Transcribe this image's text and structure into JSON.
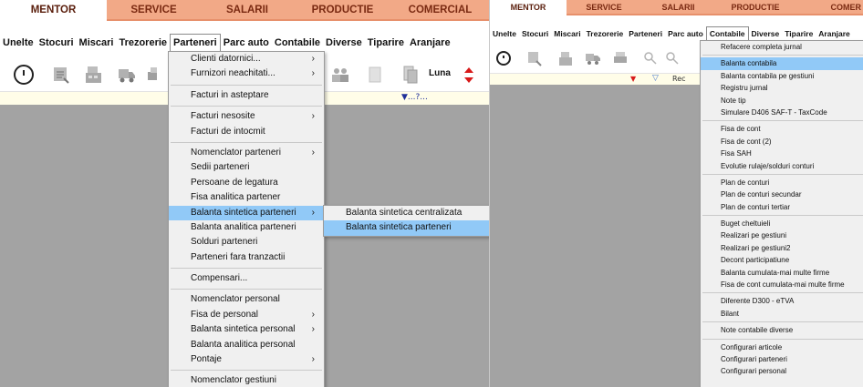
{
  "left": {
    "tabs": [
      "MENTOR",
      "SERVICE",
      "SALARII",
      "PRODUCTIE",
      "COMERCIAL"
    ],
    "menubar": [
      "Unelte",
      "Stocuri",
      "Miscari",
      "Trezorerie",
      "Parteneri",
      "Parc auto",
      "Contabile",
      "Diverse",
      "Tiparire",
      "Aranjare"
    ],
    "toolbar": {
      "luna_label": "Luna",
      "strip_text": "▼...?..."
    },
    "parteneri_menu": [
      {
        "label": "Clienti datornici...",
        "arrow": "›"
      },
      {
        "label": "Furnizori neachitati...",
        "arrow": "›"
      },
      {
        "sep": true
      },
      {
        "label": "Facturi in asteptare"
      },
      {
        "sep": true
      },
      {
        "label": "Facturi nesosite",
        "arrow": "›"
      },
      {
        "label": "Facturi de intocmit"
      },
      {
        "sep": true
      },
      {
        "label": "Nomenclator parteneri",
        "arrow": "›"
      },
      {
        "label": "Sedii parteneri"
      },
      {
        "label": "Persoane de legatura"
      },
      {
        "label": "Fisa analitica partener"
      },
      {
        "label": "Balanta sintetica parteneri",
        "arrow": "›",
        "highlight": true
      },
      {
        "label": "Balanta analitica parteneri"
      },
      {
        "label": "Solduri parteneri"
      },
      {
        "label": "Parteneri fara tranzactii"
      },
      {
        "sep": true
      },
      {
        "label": "Compensari..."
      },
      {
        "sep": true
      },
      {
        "label": "Nomenclator personal"
      },
      {
        "label": "Fisa de personal",
        "arrow": "›"
      },
      {
        "label": "Balanta sintetica personal",
        "arrow": "›"
      },
      {
        "label": "Balanta analitica personal"
      },
      {
        "label": "Pontaje",
        "arrow": "›"
      },
      {
        "sep": true
      },
      {
        "label": "Nomenclator gestiuni"
      }
    ],
    "balanta_submenu": [
      {
        "label": "Balanta sintetica centralizata"
      },
      {
        "label": "Balanta sintetica parteneri",
        "highlight": true
      }
    ]
  },
  "right": {
    "tabs": [
      "MENTOR",
      "SERVICE",
      "SALARII",
      "PRODUCTIE",
      "COMER"
    ],
    "menubar": [
      "Unelte",
      "Stocuri",
      "Miscari",
      "Trezorerie",
      "Parteneri",
      "Parc auto",
      "Contabile",
      "Diverse",
      "Tiparire",
      "Aranjare"
    ],
    "toolbar": {
      "strip_text": "Rec"
    },
    "contabile_menu": [
      {
        "label": "Refacere completa jurnal"
      },
      {
        "sep": true
      },
      {
        "label": "Balanta contabila",
        "highlight": true
      },
      {
        "label": "Balanta contabila pe gestiuni"
      },
      {
        "label": "Registru jurnal"
      },
      {
        "label": "Note tip"
      },
      {
        "label": "Simulare D406 SAF-T - TaxCode"
      },
      {
        "sep": true
      },
      {
        "label": "Fisa de cont"
      },
      {
        "label": "Fisa de cont (2)"
      },
      {
        "label": "Fisa SAH"
      },
      {
        "label": "Evolutie rulaje/solduri conturi"
      },
      {
        "sep": true
      },
      {
        "label": "Plan de conturi"
      },
      {
        "label": "Plan de conturi secundar"
      },
      {
        "label": "Plan de conturi tertiar"
      },
      {
        "sep": true
      },
      {
        "label": "Buget cheltuieli"
      },
      {
        "label": "Realizari pe gestiuni"
      },
      {
        "label": "Realizari pe gestiuni2"
      },
      {
        "label": "Decont participatiune"
      },
      {
        "label": "Balanta cumulata-mai multe firme"
      },
      {
        "label": "Fisa de cont cumulata-mai multe firme"
      },
      {
        "sep": true
      },
      {
        "label": "Diferente D300 - eTVA"
      },
      {
        "label": "Bilant"
      },
      {
        "sep": true
      },
      {
        "label": "Note contabile diverse"
      },
      {
        "sep": true
      },
      {
        "label": "Configurari articole"
      },
      {
        "label": "Configurari parteneri"
      },
      {
        "label": "Configurari personal"
      }
    ]
  },
  "colors": {
    "tab_inactive": "#f2a987",
    "menu_highlight": "#91c9f7",
    "workspace": "#a3a3a3",
    "arrow_red": "#d81a1a"
  }
}
